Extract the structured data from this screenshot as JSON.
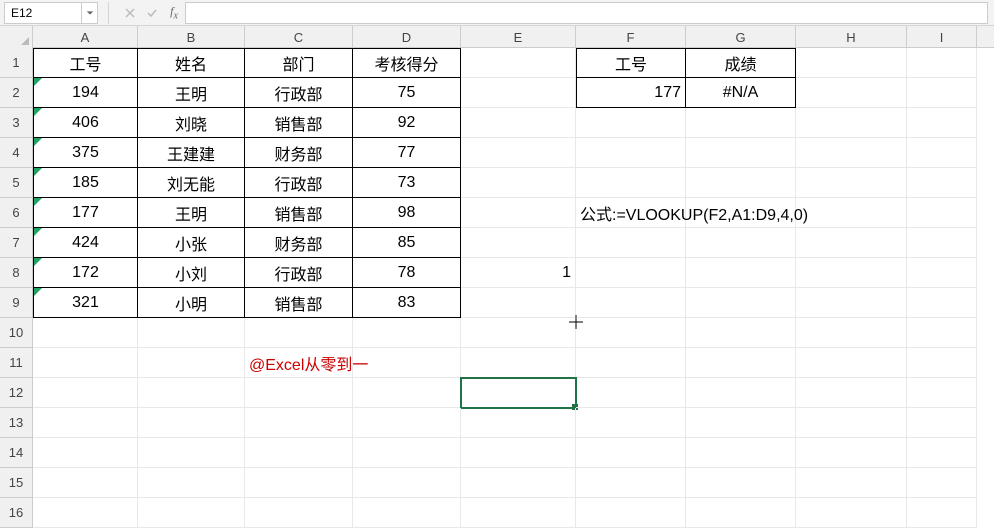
{
  "name_box": "E12",
  "formula_input": "",
  "columns": [
    {
      "label": "A",
      "w": 105
    },
    {
      "label": "B",
      "w": 107
    },
    {
      "label": "C",
      "w": 108
    },
    {
      "label": "D",
      "w": 108
    },
    {
      "label": "E",
      "w": 115
    },
    {
      "label": "F",
      "w": 110
    },
    {
      "label": "G",
      "w": 110
    },
    {
      "label": "H",
      "w": 111
    },
    {
      "label": "I",
      "w": 70
    }
  ],
  "row_labels": [
    "1",
    "2",
    "3",
    "4",
    "5",
    "6",
    "7",
    "8",
    "9",
    "10",
    "11",
    "12",
    "13",
    "14",
    "15",
    "16"
  ],
  "table_headers": [
    "工号",
    "姓名",
    "部门",
    "考核得分"
  ],
  "table_rows": [
    {
      "id": "194",
      "name": "王明",
      "dept": "行政部",
      "score": "75"
    },
    {
      "id": "406",
      "name": "刘晓",
      "dept": "销售部",
      "score": "92"
    },
    {
      "id": "375",
      "name": "王建建",
      "dept": "财务部",
      "score": "77"
    },
    {
      "id": "185",
      "name": "刘无能",
      "dept": "行政部",
      "score": "73"
    },
    {
      "id": "177",
      "name": "王明",
      "dept": "销售部",
      "score": "98"
    },
    {
      "id": "424",
      "name": "小张",
      "dept": "财务部",
      "score": "85"
    },
    {
      "id": "172",
      "name": "小刘",
      "dept": "行政部",
      "score": "78"
    },
    {
      "id": "321",
      "name": "小明",
      "dept": "销售部",
      "score": "83"
    }
  ],
  "lookup": {
    "hdr_id": "工号",
    "hdr_score": "成绩",
    "val_id": "177",
    "val_score": "#N/A"
  },
  "formula_note": "公式:=VLOOKUP(F2,A1:D9,4,0)",
  "e8_value": "1",
  "watermark": "@Excel从零到一",
  "selected_cell": "E12"
}
